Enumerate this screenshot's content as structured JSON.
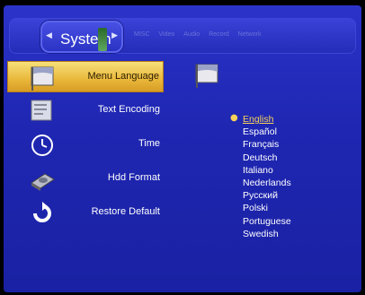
{
  "header": {
    "active_tab": "System",
    "tabs": [
      "MISC",
      "Video",
      "Audio",
      "Record",
      "Network"
    ]
  },
  "menu": {
    "items": [
      {
        "label": "Menu Language",
        "icon": "flag-icon",
        "selected": true
      },
      {
        "label": "Text Encoding",
        "icon": "document-flag-icon",
        "selected": false
      },
      {
        "label": "Time",
        "icon": "clock-icon",
        "selected": false
      },
      {
        "label": "Hdd Format",
        "icon": "hard-drive-icon",
        "selected": false
      },
      {
        "label": "Restore Default",
        "icon": "restore-icon",
        "selected": false
      }
    ]
  },
  "languages": {
    "selected": "English",
    "items": [
      "English",
      "Español",
      "Français",
      "Deutsch",
      "Italiano",
      "Nederlands",
      "Русский",
      "Polski",
      "Portuguese",
      "Swedish"
    ]
  },
  "colors": {
    "background": "#2028b8",
    "highlight": "#e9b73a",
    "selected_text": "#f7d25a"
  }
}
